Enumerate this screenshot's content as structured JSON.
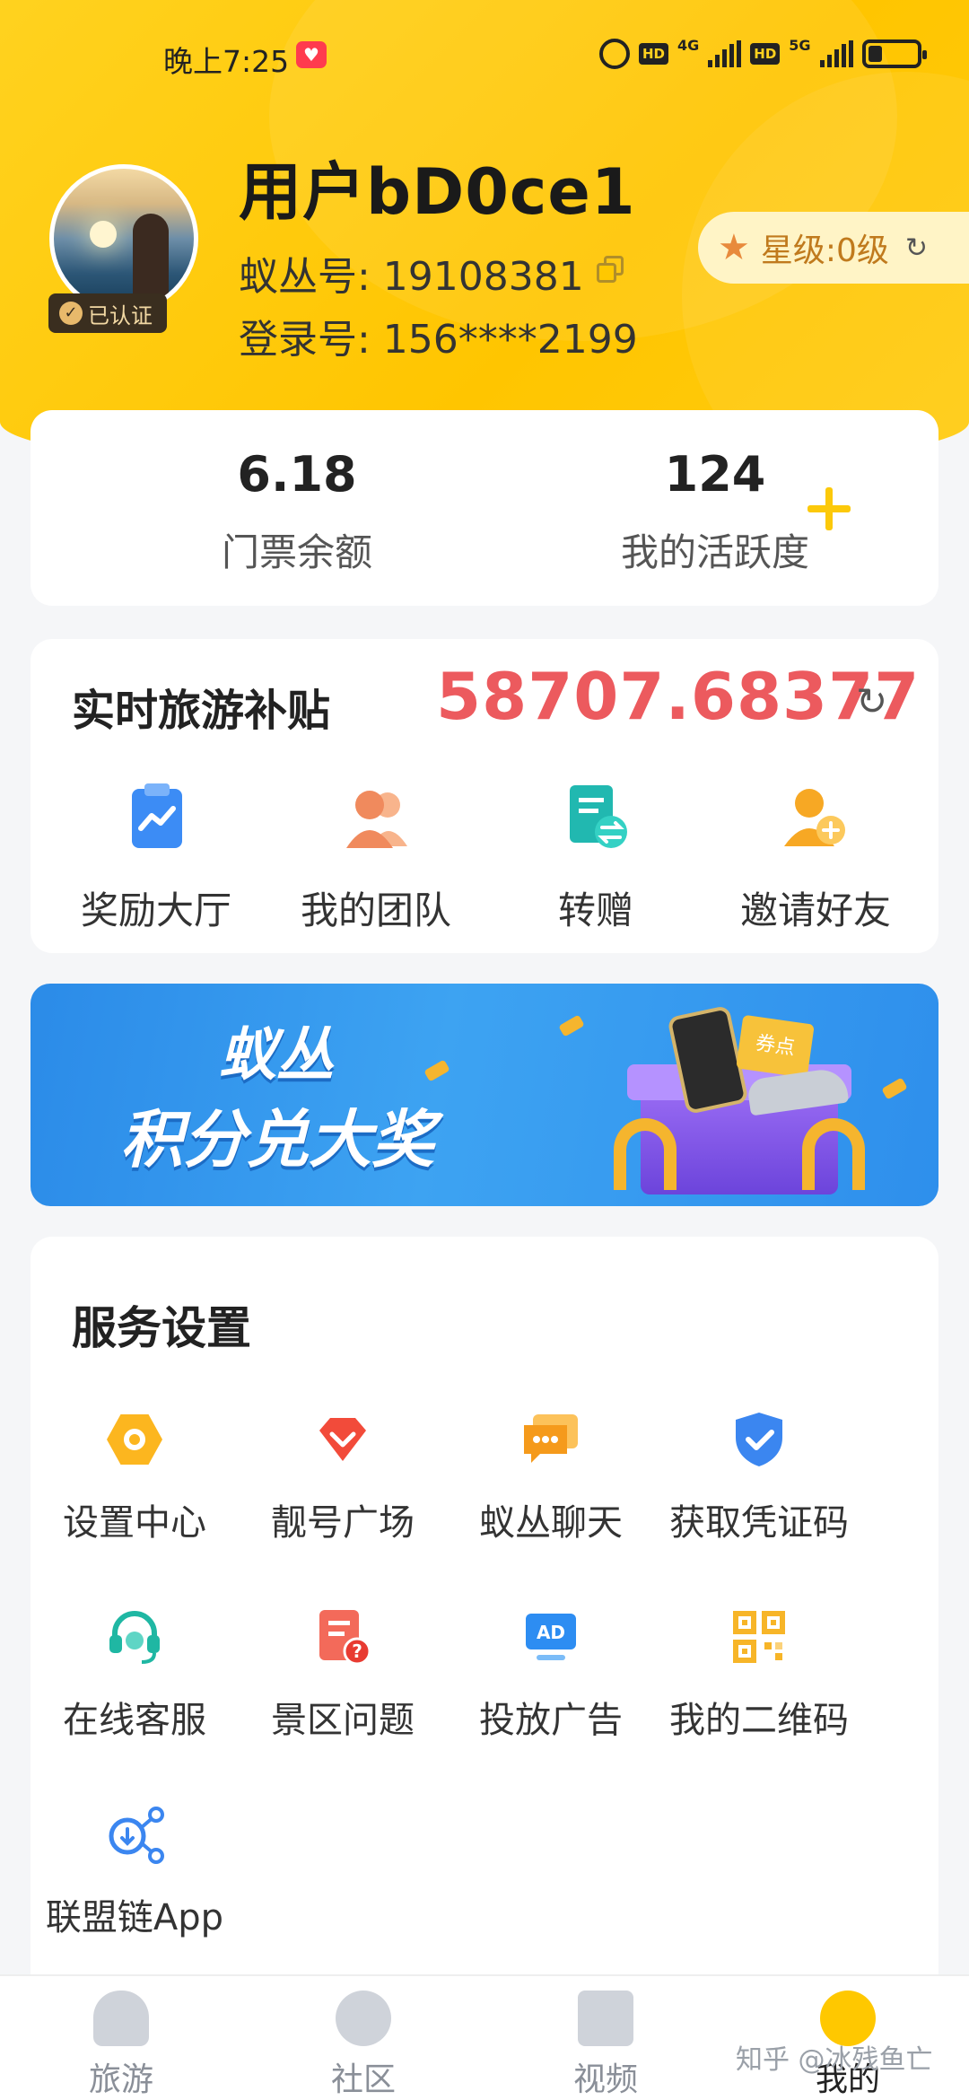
{
  "status_bar": {
    "time": "晚上7:25",
    "heart_icon": "heart-badge-icon",
    "hd1": "HD",
    "net1": "4G",
    "hd2": "HD",
    "net2": "5G",
    "battery_level": 0.3
  },
  "profile": {
    "username": "用户bD0ce1",
    "id_label": "蚁丛号: 19108381",
    "login_label": "登录号: 156****2199",
    "verified": "已认证",
    "star_level": "星级:0级"
  },
  "stats": {
    "balance_value": "6.18",
    "balance_label": "门票余额",
    "activity_value": "124",
    "activity_label": "我的活跃度"
  },
  "subsidy": {
    "title": "实时旅游补贴",
    "value": "58707.68377",
    "actions": [
      {
        "label": "奖励大厅",
        "icon": "reward-hall-icon"
      },
      {
        "label": "我的团队",
        "icon": "team-icon"
      },
      {
        "label": "转赠",
        "icon": "transfer-icon"
      },
      {
        "label": "邀请好友",
        "icon": "invite-friend-icon"
      }
    ]
  },
  "banner": {
    "line1": "蚁丛",
    "line2": "积分兑大奖",
    "card_text": "券点"
  },
  "services": {
    "title": "服务设置",
    "items": [
      {
        "label": "设置中心",
        "icon": "settings-hex-icon"
      },
      {
        "label": "靓号广场",
        "icon": "diamond-icon"
      },
      {
        "label": "蚁丛聊天",
        "icon": "chat-icon"
      },
      {
        "label": "获取凭证码",
        "icon": "shield-check-icon"
      },
      {
        "label": "在线客服",
        "icon": "headset-icon"
      },
      {
        "label": "景区问题",
        "icon": "question-doc-icon"
      },
      {
        "label": "投放广告",
        "icon": "ad-icon"
      },
      {
        "label": "我的二维码",
        "icon": "qr-code-icon"
      },
      {
        "label": "联盟链App",
        "icon": "share-chain-icon"
      }
    ]
  },
  "bottom_nav": {
    "items": [
      {
        "label": "旅游",
        "icon": "home-icon"
      },
      {
        "label": "社区",
        "icon": "community-icon"
      },
      {
        "label": "视频",
        "icon": "video-icon"
      },
      {
        "label": "我的",
        "icon": "me-icon"
      }
    ]
  },
  "watermark": "知乎 @冰残鱼亡",
  "colors": {
    "brand_yellow": "#ffc800",
    "subsidy_red": "#ec5a5e",
    "plus_yellow": "#fcc90a"
  }
}
